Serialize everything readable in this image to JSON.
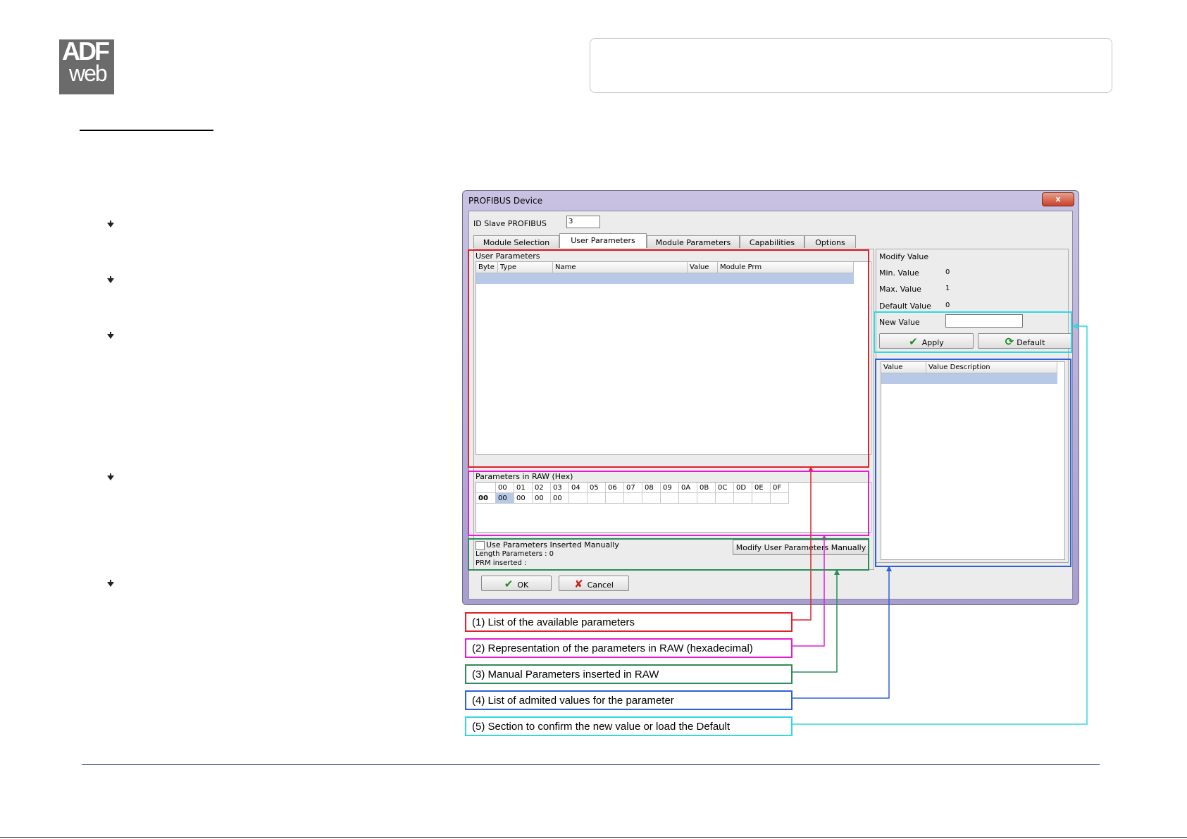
{
  "logo": {
    "line1": "ADF",
    "line2": "web"
  },
  "dialog": {
    "title": "PROFIBUS Device",
    "close_label": "x",
    "id_slave_label": "ID Slave PROFIBUS",
    "id_slave_value": "3",
    "tabs": [
      "Module Selection",
      "User Parameters",
      "Module Parameters",
      "Capabilities",
      "Options"
    ],
    "active_tab": "User Parameters",
    "user_params": {
      "label": "User Parameters",
      "columns": [
        "Byte",
        "Type",
        "Name",
        "Value",
        "Module Prm"
      ]
    },
    "modify": {
      "label": "Modify Value",
      "min_label": "Min. Value",
      "min_value": "0",
      "max_label": "Max. Value",
      "max_value": "1",
      "default_label": "Default Value",
      "default_value": "0",
      "new_label": "New Value",
      "new_value": "",
      "apply_label": "Apply",
      "default_button_label": "Default"
    },
    "values_table": {
      "columns": [
        "Value",
        "Value Description"
      ]
    },
    "raw": {
      "label": "Parameters in RAW (Hex)",
      "columns": [
        "00",
        "01",
        "02",
        "03",
        "04",
        "05",
        "06",
        "07",
        "08",
        "09",
        "0A",
        "0B",
        "0C",
        "0D",
        "0E",
        "0F"
      ],
      "row_label": "00",
      "row_values": [
        "00",
        "00",
        "00",
        "00"
      ]
    },
    "manual": {
      "checkbox_label": "Use Parameters Inserted Manually",
      "length_text": "Length Parameters : 0",
      "prm_text": "PRM inserted :",
      "button_label": "Modify User Parameters Manually"
    },
    "ok_label": "OK",
    "cancel_label": "Cancel"
  },
  "callouts": [
    {
      "text": "(1) List of the available parameters",
      "color": "#e0202a"
    },
    {
      "text": "(2) Representation of the parameters in RAW (hexadecimal)",
      "color": "#e020d0"
    },
    {
      "text": "(3) Manual Parameters inserted in RAW",
      "color": "#2e8a5a"
    },
    {
      "text": "(4) List of admited values for the parameter",
      "color": "#3060d8"
    },
    {
      "text": "(5) Section to confirm the new value or load the Default",
      "color": "#30d8e0"
    }
  ]
}
